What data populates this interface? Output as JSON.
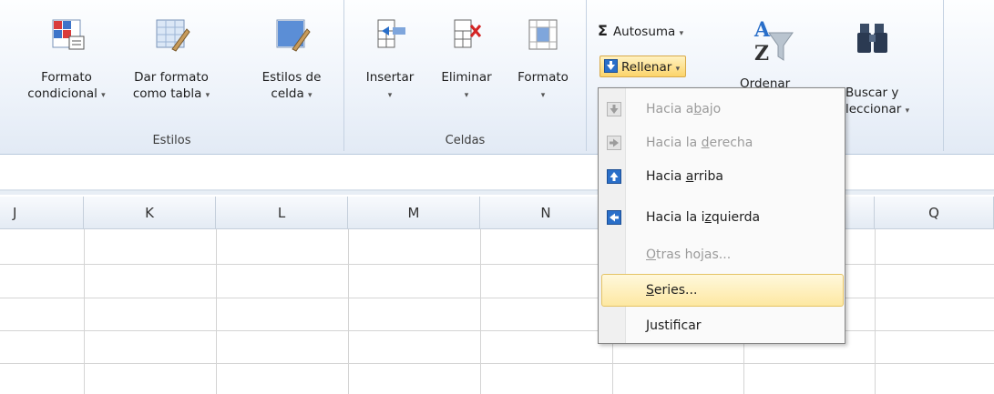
{
  "ribbon": {
    "estilos": {
      "label": "Estilos",
      "formato_condicional": {
        "line1": "Formato",
        "line2": "condicional"
      },
      "dar_formato_tabla": {
        "line1": "Dar formato",
        "line2": "como tabla"
      },
      "estilos_celda": {
        "line1": "Estilos de",
        "line2": "celda"
      }
    },
    "celdas": {
      "label": "Celdas",
      "insertar": "Insertar",
      "eliminar": "Eliminar",
      "formato": "Formato"
    },
    "modificar": {
      "autosuma": "Autosuma",
      "rellenar": "Rellenar",
      "ordenar_partial": "Ordenar",
      "buscar": {
        "line1": "Buscar y",
        "line2": "leccionar"
      }
    },
    "sigma_glyph": "Σ",
    "dropdown_arrow": "▾"
  },
  "columns": [
    "J",
    "K",
    "L",
    "M",
    "N",
    "Q"
  ],
  "menu": {
    "items": [
      {
        "pre": "Hacia a",
        "u": "b",
        "post": "ajo",
        "disabled": true,
        "icon": "fill-down-icon"
      },
      {
        "pre": "Hacia la ",
        "u": "d",
        "post": "erecha",
        "disabled": true,
        "icon": "fill-right-icon"
      },
      {
        "pre": "Hacia ",
        "u": "a",
        "post": "rriba",
        "disabled": false,
        "icon": "fill-up-icon"
      },
      {
        "pre": "Hacia la i",
        "u": "z",
        "post": "quierda",
        "disabled": false,
        "icon": "fill-left-icon"
      },
      {
        "pre": "",
        "u": "O",
        "post": "tras hojas...",
        "disabled": true,
        "icon": ""
      },
      {
        "pre": "",
        "u": "S",
        "post": "eries...",
        "disabled": false,
        "icon": "",
        "highlighted": true
      },
      {
        "pre": "",
        "u": "J",
        "post": "ustificar",
        "disabled": false,
        "icon": ""
      }
    ]
  },
  "colors": {
    "accent_blue": "#2a6fc9",
    "highlight": "#fde8a2"
  }
}
